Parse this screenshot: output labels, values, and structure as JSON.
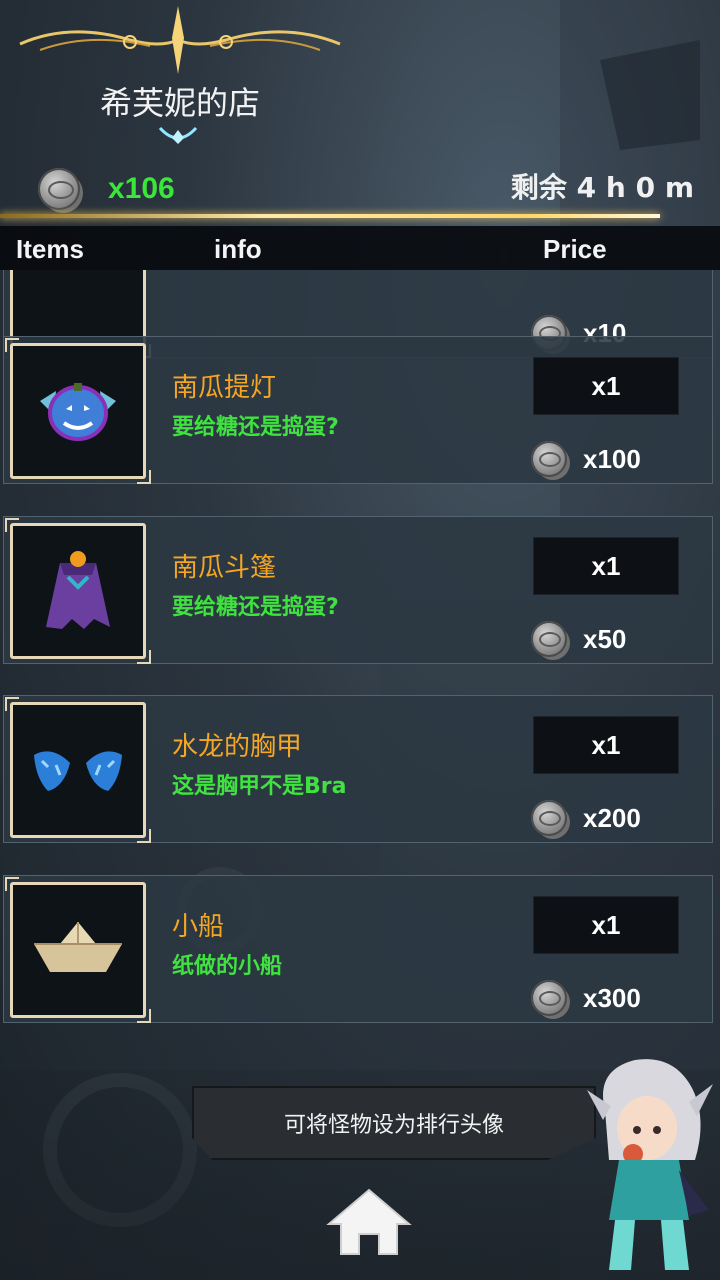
{
  "header": {
    "shop_title": "希芙妮的店",
    "coin_count": "x106",
    "time_remaining": "剩余 4 h 0 m"
  },
  "columns": {
    "items": "Items",
    "info": "info",
    "price": "Price"
  },
  "partial_item": {
    "price": "x10"
  },
  "items": [
    {
      "name": "南瓜提灯",
      "desc": "要给糖还是捣蛋?",
      "qty": "x1",
      "price": "x100",
      "icon": "pumpkin-lantern-icon"
    },
    {
      "name": "南瓜斗篷",
      "desc": "要给糖还是捣蛋?",
      "qty": "x1",
      "price": "x50",
      "icon": "pumpkin-cloak-icon"
    },
    {
      "name": "水龙的胸甲",
      "desc": "这是胸甲不是Bra",
      "qty": "x1",
      "price": "x200",
      "icon": "water-dragon-armor-icon"
    },
    {
      "name": "小船",
      "desc": "纸做的小船",
      "qty": "x1",
      "price": "x300",
      "icon": "paper-boat-icon"
    }
  ],
  "footer": {
    "tip": "可将怪物设为排行头像",
    "home_icon": "home-icon"
  },
  "colors": {
    "item_name": "#f5a623",
    "item_desc": "#3fe23f",
    "coin_count": "#39e639",
    "gold_trim": "#ffd66b"
  }
}
